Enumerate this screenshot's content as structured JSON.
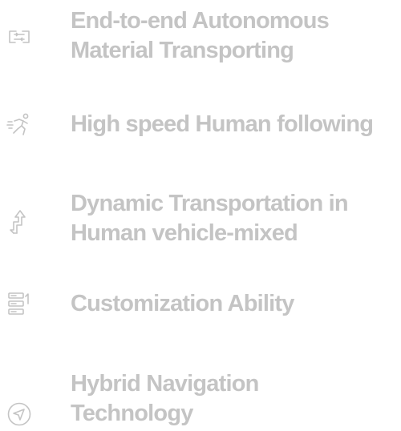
{
  "colors": {
    "text": "#c4c4c4",
    "icon": "#c4c4c4",
    "background": "#ffffff"
  },
  "features": [
    {
      "icon": "transport-route-icon",
      "lines": [
        "End-to-end Autonomous",
        "Material Transporting"
      ]
    },
    {
      "icon": "running-person-icon",
      "lines": [
        "High speed Human following"
      ]
    },
    {
      "icon": "dynamic-arrows-icon",
      "lines": [
        "Dynamic Transportation in",
        "Human vehicle-mixed"
      ]
    },
    {
      "icon": "customization-icon",
      "lines": [
        "Customization Ability"
      ]
    },
    {
      "icon": "navigation-icon",
      "lines": [
        "Hybrid Navigation",
        "Technology"
      ]
    }
  ]
}
